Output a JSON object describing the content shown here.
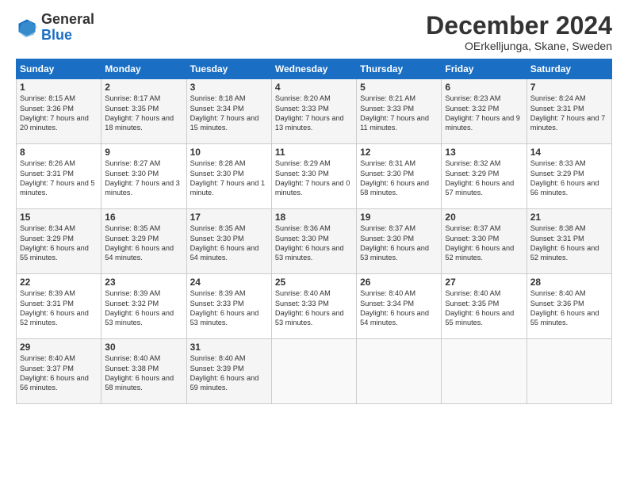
{
  "header": {
    "logo_general": "General",
    "logo_blue": "Blue",
    "month_title": "December 2024",
    "subtitle": "OErkelljunga, Skane, Sweden"
  },
  "calendar": {
    "days_of_week": [
      "Sunday",
      "Monday",
      "Tuesday",
      "Wednesday",
      "Thursday",
      "Friday",
      "Saturday"
    ],
    "weeks": [
      [
        {
          "day": "1",
          "sunrise": "8:15 AM",
          "sunset": "3:36 PM",
          "daylight": "7 hours and 20 minutes."
        },
        {
          "day": "2",
          "sunrise": "8:17 AM",
          "sunset": "3:35 PM",
          "daylight": "7 hours and 18 minutes."
        },
        {
          "day": "3",
          "sunrise": "8:18 AM",
          "sunset": "3:34 PM",
          "daylight": "7 hours and 15 minutes."
        },
        {
          "day": "4",
          "sunrise": "8:20 AM",
          "sunset": "3:33 PM",
          "daylight": "7 hours and 13 minutes."
        },
        {
          "day": "5",
          "sunrise": "8:21 AM",
          "sunset": "3:33 PM",
          "daylight": "7 hours and 11 minutes."
        },
        {
          "day": "6",
          "sunrise": "8:23 AM",
          "sunset": "3:32 PM",
          "daylight": "7 hours and 9 minutes."
        },
        {
          "day": "7",
          "sunrise": "8:24 AM",
          "sunset": "3:31 PM",
          "daylight": "7 hours and 7 minutes."
        }
      ],
      [
        {
          "day": "8",
          "sunrise": "8:26 AM",
          "sunset": "3:31 PM",
          "daylight": "7 hours and 5 minutes."
        },
        {
          "day": "9",
          "sunrise": "8:27 AM",
          "sunset": "3:30 PM",
          "daylight": "7 hours and 3 minutes."
        },
        {
          "day": "10",
          "sunrise": "8:28 AM",
          "sunset": "3:30 PM",
          "daylight": "7 hours and 1 minute."
        },
        {
          "day": "11",
          "sunrise": "8:29 AM",
          "sunset": "3:30 PM",
          "daylight": "7 hours and 0 minutes."
        },
        {
          "day": "12",
          "sunrise": "8:31 AM",
          "sunset": "3:30 PM",
          "daylight": "6 hours and 58 minutes."
        },
        {
          "day": "13",
          "sunrise": "8:32 AM",
          "sunset": "3:29 PM",
          "daylight": "6 hours and 57 minutes."
        },
        {
          "day": "14",
          "sunrise": "8:33 AM",
          "sunset": "3:29 PM",
          "daylight": "6 hours and 56 minutes."
        }
      ],
      [
        {
          "day": "15",
          "sunrise": "8:34 AM",
          "sunset": "3:29 PM",
          "daylight": "6 hours and 55 minutes."
        },
        {
          "day": "16",
          "sunrise": "8:35 AM",
          "sunset": "3:29 PM",
          "daylight": "6 hours and 54 minutes."
        },
        {
          "day": "17",
          "sunrise": "8:35 AM",
          "sunset": "3:30 PM",
          "daylight": "6 hours and 54 minutes."
        },
        {
          "day": "18",
          "sunrise": "8:36 AM",
          "sunset": "3:30 PM",
          "daylight": "6 hours and 53 minutes."
        },
        {
          "day": "19",
          "sunrise": "8:37 AM",
          "sunset": "3:30 PM",
          "daylight": "6 hours and 53 minutes."
        },
        {
          "day": "20",
          "sunrise": "8:37 AM",
          "sunset": "3:30 PM",
          "daylight": "6 hours and 52 minutes."
        },
        {
          "day": "21",
          "sunrise": "8:38 AM",
          "sunset": "3:31 PM",
          "daylight": "6 hours and 52 minutes."
        }
      ],
      [
        {
          "day": "22",
          "sunrise": "8:39 AM",
          "sunset": "3:31 PM",
          "daylight": "6 hours and 52 minutes."
        },
        {
          "day": "23",
          "sunrise": "8:39 AM",
          "sunset": "3:32 PM",
          "daylight": "6 hours and 53 minutes."
        },
        {
          "day": "24",
          "sunrise": "8:39 AM",
          "sunset": "3:33 PM",
          "daylight": "6 hours and 53 minutes."
        },
        {
          "day": "25",
          "sunrise": "8:40 AM",
          "sunset": "3:33 PM",
          "daylight": "6 hours and 53 minutes."
        },
        {
          "day": "26",
          "sunrise": "8:40 AM",
          "sunset": "3:34 PM",
          "daylight": "6 hours and 54 minutes."
        },
        {
          "day": "27",
          "sunrise": "8:40 AM",
          "sunset": "3:35 PM",
          "daylight": "6 hours and 55 minutes."
        },
        {
          "day": "28",
          "sunrise": "8:40 AM",
          "sunset": "3:36 PM",
          "daylight": "6 hours and 55 minutes."
        }
      ],
      [
        {
          "day": "29",
          "sunrise": "8:40 AM",
          "sunset": "3:37 PM",
          "daylight": "6 hours and 56 minutes."
        },
        {
          "day": "30",
          "sunrise": "8:40 AM",
          "sunset": "3:38 PM",
          "daylight": "6 hours and 58 minutes."
        },
        {
          "day": "31",
          "sunrise": "8:40 AM",
          "sunset": "3:39 PM",
          "daylight": "6 hours and 59 minutes."
        },
        null,
        null,
        null,
        null
      ]
    ]
  }
}
